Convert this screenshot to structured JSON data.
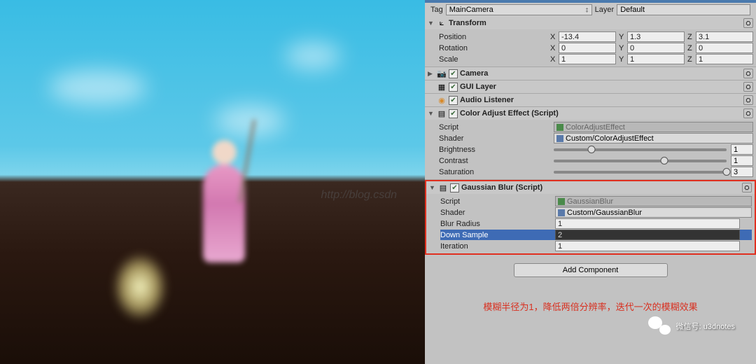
{
  "tag": {
    "label": "Tag",
    "value": "MainCamera"
  },
  "layer": {
    "label": "Layer",
    "value": "Default"
  },
  "transform": {
    "title": "Transform",
    "position": {
      "label": "Position",
      "x": "-13.4",
      "y": "1.3",
      "z": "3.1"
    },
    "rotation": {
      "label": "Rotation",
      "x": "0",
      "y": "0",
      "z": "0"
    },
    "scale": {
      "label": "Scale",
      "x": "1",
      "y": "1",
      "z": "1"
    }
  },
  "camera": {
    "title": "Camera"
  },
  "guilayer": {
    "title": "GUI Layer"
  },
  "audiolistener": {
    "title": "Audio Listener"
  },
  "colorAdjust": {
    "title": "Color Adjust Effect (Script)",
    "scriptLabel": "Script",
    "scriptValue": "ColorAdjustEffect",
    "shaderLabel": "Shader",
    "shaderValue": "Custom/ColorAdjustEffect",
    "brightness": {
      "label": "Brightness",
      "value": "1",
      "pct": 22
    },
    "contrast": {
      "label": "Contrast",
      "value": "1",
      "pct": 64
    },
    "saturation": {
      "label": "Saturation",
      "value": "3",
      "pct": 100
    }
  },
  "gaussian": {
    "title": "Gaussian Blur (Script)",
    "scriptLabel": "Script",
    "scriptValue": "GaussianBlur",
    "shaderLabel": "Shader",
    "shaderValue": "Custom/GaussianBlur",
    "blurRadius": {
      "label": "Blur Radius",
      "value": "1"
    },
    "downSample": {
      "label": "Down Sample",
      "value": "2"
    },
    "iteration": {
      "label": "Iteration",
      "value": "1"
    }
  },
  "addComponent": "Add Component",
  "caption": "模糊半径为1，降低两倍分辨率，迭代一次的模糊效果",
  "wechat": "微信号: u3dnotes",
  "watermark": "http://blog.csdn"
}
